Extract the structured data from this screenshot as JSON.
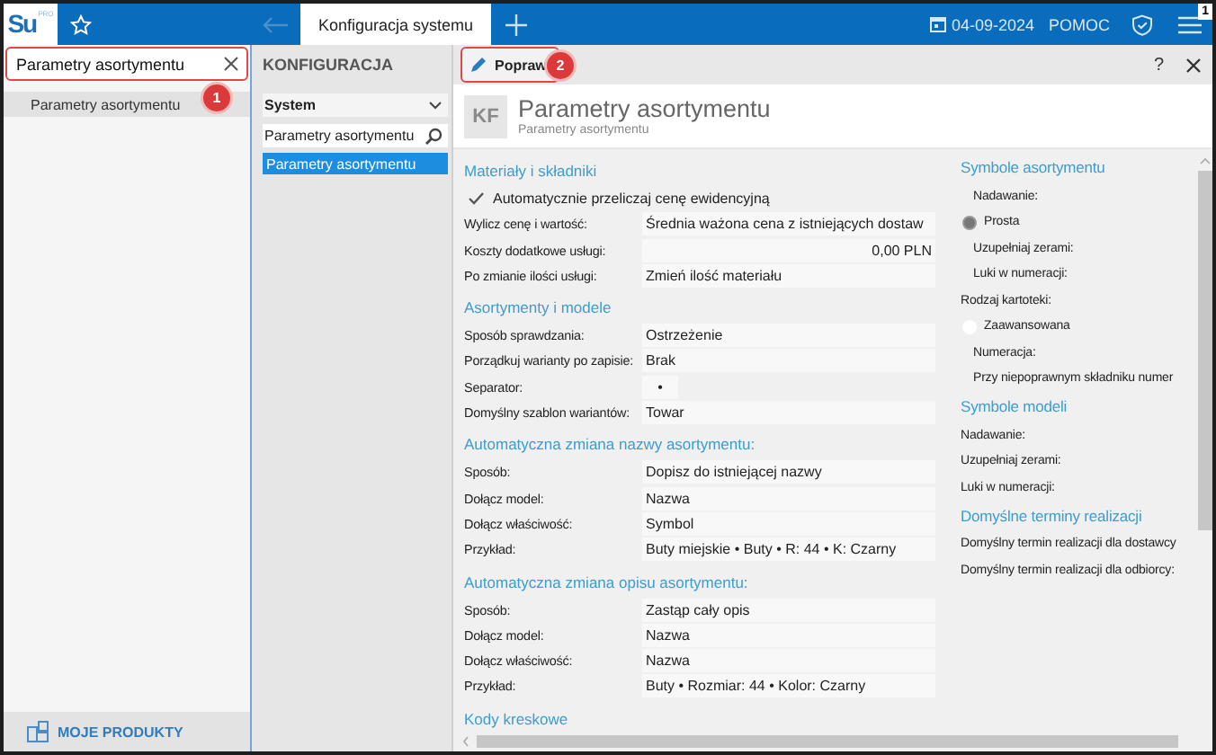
{
  "topbar": {
    "logo": "Su",
    "logo_badge": "PRO",
    "tabs": [
      {
        "label": "Konfiguracja systemu",
        "selected": true
      }
    ],
    "date": "04-09-2024",
    "help": "POMOC",
    "notification_count": "1"
  },
  "search": {
    "value": "Parametry asortymentu",
    "annotation": "1",
    "results": [
      {
        "label": "Parametry asortymentu",
        "selected": true
      }
    ],
    "footer": "MOJE PRODUKTY"
  },
  "nav": {
    "title": "KONFIGURACJA",
    "dropdown": "System",
    "search_value": "Parametry asortymentu",
    "items": [
      {
        "label": "Parametry asortymentu",
        "selected": true
      }
    ]
  },
  "toolbar": {
    "edit_button": "Popraw",
    "annotation": "2",
    "help": "?"
  },
  "header": {
    "initials": "KF",
    "title": "Parametry asortymentu",
    "subtitle": "Parametry asortymentu"
  },
  "form_sections": [
    {
      "title": "Materiały i składniki",
      "rows": [
        {
          "kind": "check",
          "label": "Automatycznie przeliczaj cenę ewidencyjną",
          "checked": true
        },
        {
          "kind": "field",
          "label": "Wylicz cenę i wartość:",
          "value": "Średnia ważona cena z istniejących dostaw"
        },
        {
          "kind": "amount",
          "label": "Koszty dodatkowe usługi:",
          "value": "0,00 PLN"
        },
        {
          "kind": "field",
          "label": "Po zmianie ilości usługi:",
          "value": "Zmień ilość materiału"
        }
      ]
    },
    {
      "title": "Asortymenty i modele",
      "rows": [
        {
          "kind": "field",
          "label": "Sposób sprawdzania:",
          "value": "Ostrzeżenie"
        },
        {
          "kind": "field",
          "label": "Porządkuj warianty po zapisie:",
          "value": "Brak"
        },
        {
          "kind": "short",
          "label": "Separator:",
          "value": "•"
        },
        {
          "kind": "field",
          "label": "Domyślny szablon wariantów:",
          "value": "Towar"
        }
      ]
    },
    {
      "title": "Automatyczna zmiana nazwy asortymentu:",
      "rows": [
        {
          "kind": "field",
          "label": "Sposób:",
          "value": "Dopisz do istniejącej nazwy"
        },
        {
          "kind": "field",
          "label": "Dołącz model:",
          "value": "Nazwa"
        },
        {
          "kind": "field",
          "label": "Dołącz właściwość:",
          "value": "Symbol"
        },
        {
          "kind": "field",
          "label": "Przykład:",
          "value": "Buty miejskie • Buty • R: 44 • K: Czarny"
        }
      ]
    },
    {
      "title": "Automatyczna zmiana opisu asortymentu:",
      "rows": [
        {
          "kind": "field",
          "label": "Sposób:",
          "value": "Zastąp cały opis"
        },
        {
          "kind": "field",
          "label": "Dołącz model:",
          "value": "Nazwa"
        },
        {
          "kind": "field",
          "label": "Dołącz właściwość:",
          "value": "Nazwa"
        },
        {
          "kind": "field",
          "label": "Przykład:",
          "value": "Buty • Rozmiar: 44 • Kolor: Czarny"
        }
      ]
    },
    {
      "title": "Kody kreskowe"
    }
  ],
  "side_sections": [
    {
      "title": "Symbole asortymentu",
      "items": [
        {
          "kind": "sub",
          "label": "Nadawanie:"
        },
        {
          "kind": "radio",
          "label": "Prosta",
          "selected": true
        },
        {
          "kind": "sub",
          "label": "Uzupełniaj zerami:"
        },
        {
          "kind": "sub",
          "label": "Luki w numeracji:"
        },
        {
          "kind": "label",
          "label": "Rodzaj kartoteki:"
        },
        {
          "kind": "radio",
          "label": "Zaawansowana",
          "selected": false
        },
        {
          "kind": "sub",
          "label": "Numeracja:"
        },
        {
          "kind": "sub",
          "label": "Przy niepoprawnym składniku numer"
        }
      ]
    },
    {
      "title": "Symbole modeli",
      "items": [
        {
          "kind": "label",
          "label": "Nadawanie:"
        },
        {
          "kind": "label",
          "label": "Uzupełniaj zerami:"
        },
        {
          "kind": "label",
          "label": "Luki w numeracji:"
        }
      ]
    },
    {
      "title": "Domyślne terminy realizacji",
      "items": [
        {
          "kind": "label",
          "label": "Domyślny termin realizacji dla dostawcy"
        },
        {
          "kind": "label",
          "label": "Domyślny termin realizacji dla odbiorcy:"
        }
      ]
    }
  ]
}
